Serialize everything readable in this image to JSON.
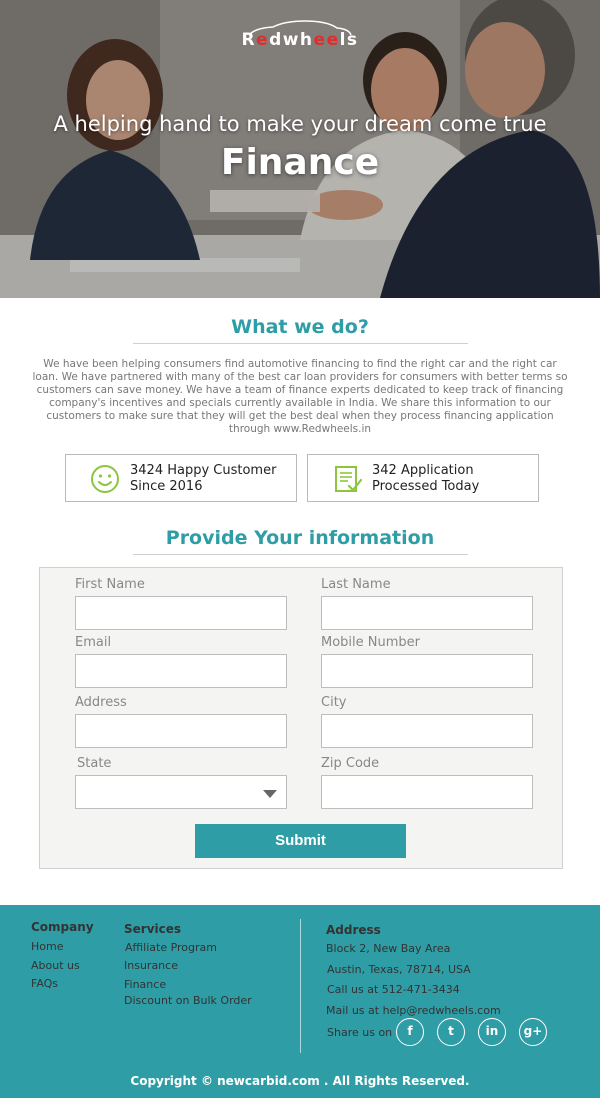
{
  "brand": {
    "prefix_letter": "R",
    "red_letters": "e",
    "rest1": "dwh",
    "red2": "ee",
    "rest2": "ls"
  },
  "hero": {
    "tagline": "A helping hand to make your dream come true",
    "title": "Finance"
  },
  "what_we_do": {
    "title": "What we do?",
    "paragraph": "We have been helping consumers find automotive financing to find the right car and the right car loan. We have partnered with many of the best car loan providers for consumers with better terms so customers can save money. We have a team of finance experts dedicated to keep track of financing company's incentives and specials currently available in India. We share this information to our customers to make sure that they will get the best deal when they process financing application through www.Redwheels.in"
  },
  "stats": [
    {
      "icon": "smiley-icon",
      "line1": "3424 Happy Customer",
      "line2": "Since 2016"
    },
    {
      "icon": "document-check-icon",
      "line1": "342 Application",
      "line2": "Processed Today"
    }
  ],
  "form": {
    "title": "Provide Your information",
    "first_name": "First Name",
    "last_name": "Last Name",
    "email": "Email",
    "mobile": "Mobile Number",
    "address": "Address",
    "city": "City",
    "state": "State",
    "zip": "Zip Code",
    "submit": "Submit"
  },
  "footer": {
    "company_title": "Company",
    "company_links": [
      "Home",
      "About us",
      "FAQs"
    ],
    "services_title": "Services",
    "services_links": [
      "Affiliate Program",
      "Insurance",
      "Finance",
      "Discount on Bulk Order"
    ],
    "address_title": "Address",
    "address_lines": [
      "Block 2, New Bay Area",
      "Austin, Texas, 78714, USA",
      "Call us at 512-471-3434",
      "Mail us at help@redwheels.com"
    ],
    "share_label": "Share us on",
    "social": [
      {
        "icon": "facebook-icon",
        "glyph": "f"
      },
      {
        "icon": "twitter-icon",
        "glyph": "t"
      },
      {
        "icon": "linkedin-icon",
        "glyph": "in"
      },
      {
        "icon": "googleplus-icon",
        "glyph": "g+"
      }
    ],
    "copyright": "Copyright ©  newcarbid.com . All Rights Reserved."
  },
  "colors": {
    "accent": "#2e9da5",
    "brand_red": "#e02d2d",
    "icon_green": "#8cc63f"
  }
}
